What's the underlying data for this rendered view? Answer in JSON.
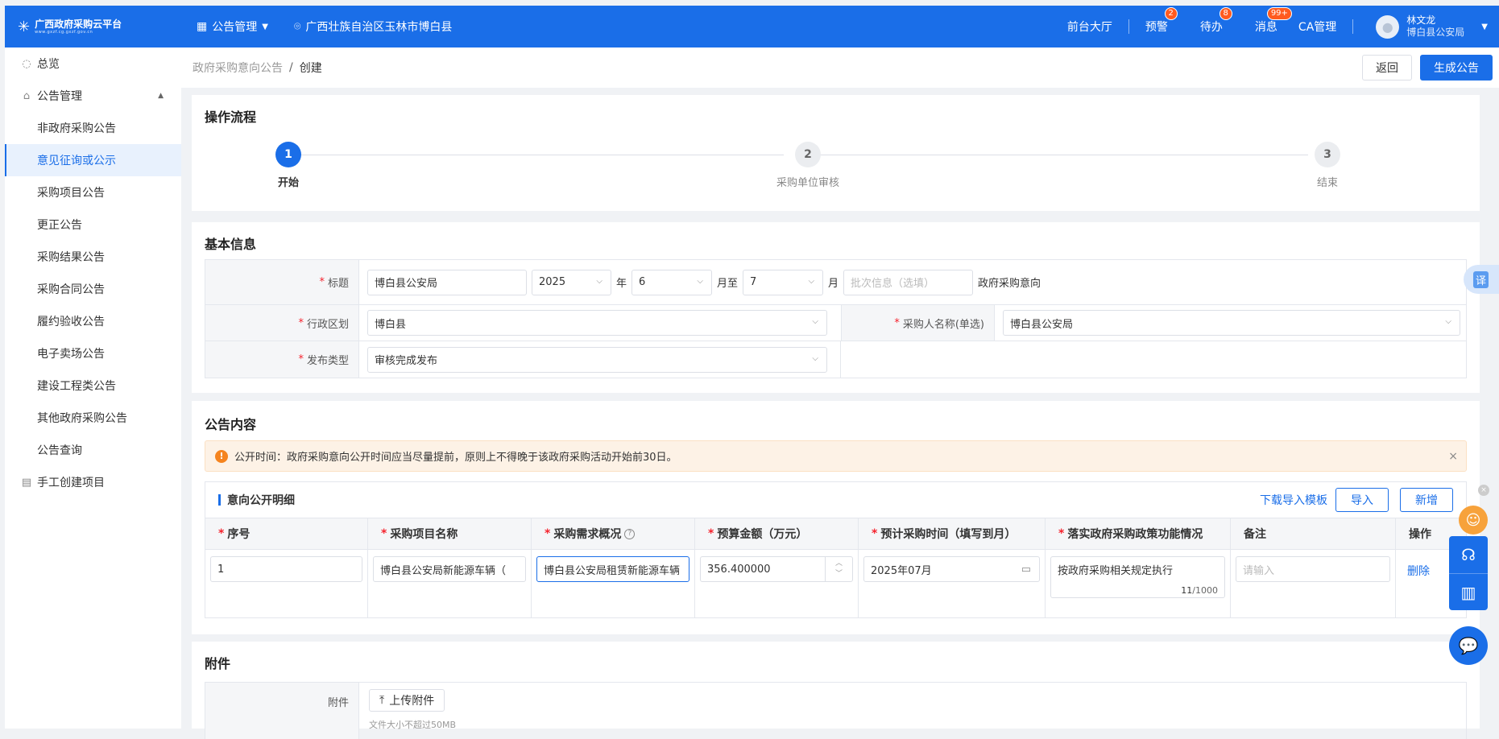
{
  "topbar": {
    "logo_title": "广西政府采购云平台",
    "logo_sub": "www.gxzf.cg.gxzf.gov.cn",
    "nav_label": "公告管理",
    "location": "广西壮族自治区玉林市博白县",
    "links": [
      {
        "label": "前台大厅",
        "badge": ""
      },
      {
        "label": "预警",
        "badge": "2"
      },
      {
        "label": "待办",
        "badge": "8"
      },
      {
        "label": "消息",
        "badge": "99+"
      },
      {
        "label": "CA管理",
        "badge": ""
      }
    ],
    "user_name": "林文龙",
    "user_org": "博白县公安局"
  },
  "sidebar": {
    "items": [
      {
        "label": "总览"
      },
      {
        "label": "公告管理"
      },
      {
        "label": "非政府采购公告"
      },
      {
        "label": "意见征询或公示"
      },
      {
        "label": "采购项目公告"
      },
      {
        "label": "更正公告"
      },
      {
        "label": "采购结果公告"
      },
      {
        "label": "采购合同公告"
      },
      {
        "label": "履约验收公告"
      },
      {
        "label": "电子卖场公告"
      },
      {
        "label": "建设工程类公告"
      },
      {
        "label": "其他政府采购公告"
      },
      {
        "label": "公告查询"
      },
      {
        "label": "手工创建项目"
      }
    ]
  },
  "breadcrumb": {
    "parent": "政府采购意向公告",
    "sep": "/",
    "current": "创建"
  },
  "buttons": {
    "back": "返回",
    "generate": "生成公告"
  },
  "flow": {
    "title": "操作流程",
    "steps": [
      {
        "num": "1",
        "label": "开始"
      },
      {
        "num": "2",
        "label": "采购单位审核"
      },
      {
        "num": "3",
        "label": "结束"
      }
    ]
  },
  "basic": {
    "title": "基本信息",
    "title_label": "标题",
    "title_value": "博白县公安局",
    "year": "2025",
    "year_unit": "年",
    "month_from": "6",
    "month_to_unit": "月至",
    "month_to": "7",
    "month_unit": "月",
    "batch_placeholder": "批次信息（选填）",
    "title_suffix": "政府采购意向",
    "region_label": "行政区划",
    "region_value": "博白县",
    "purchaser_label": "采购人名称(单选)",
    "purchaser_value": "博白县公安局",
    "publish_label": "发布类型",
    "publish_value": "审核完成发布"
  },
  "content": {
    "title": "公告内容",
    "alert": "公开时间：政府采购意向公开时间应当尽量提前，原则上不得晚于该政府采购活动开始前30日。",
    "alert_close": "×",
    "detail_title": "意向公开明细",
    "download_template": "下载导入模板",
    "import": "导入",
    "add": "新增",
    "columns": [
      "序号",
      "采购项目名称",
      "采购需求概况",
      "预算金额（万元）",
      "预计采购时间（填写到月）",
      "落实政府采购政策功能情况",
      "备注",
      "操作"
    ],
    "row": {
      "index": "1",
      "project_name": "博白县公安局新能源车辆（",
      "requirement": "博白县公安局租赁新能源车辆",
      "budget": "356.400000",
      "time": "2025年07月",
      "policy": "按政府采购相关规定执行",
      "policy_count": "11",
      "policy_max": "/1000",
      "remark_placeholder": "请输入",
      "delete": "删除"
    }
  },
  "attach": {
    "title": "附件",
    "label": "附件",
    "upload": "上传附件",
    "hint": "文件大小不超过50MB"
  },
  "float": {
    "translate": "译"
  }
}
